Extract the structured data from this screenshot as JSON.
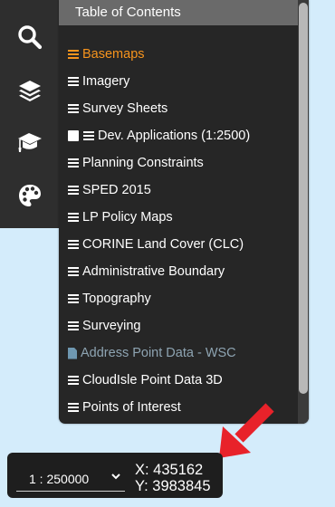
{
  "sidebar": {
    "buttons": [
      {
        "icon": "search-icon"
      },
      {
        "icon": "layers-icon"
      },
      {
        "icon": "graduation-cap-icon"
      },
      {
        "icon": "palette-icon"
      }
    ]
  },
  "toc": {
    "title": "Table of Contents",
    "items": [
      {
        "label": "Basemaps",
        "state": "active",
        "icon": "menu-icon"
      },
      {
        "label": "Imagery",
        "icon": "menu-icon"
      },
      {
        "label": "Survey Sheets",
        "icon": "menu-icon"
      },
      {
        "label": "Dev. Applications (1:2500)",
        "icon": "menu-icon",
        "checkbox": true
      },
      {
        "label": "Planning Constraints",
        "icon": "menu-icon"
      },
      {
        "label": "SPED 2015",
        "icon": "menu-icon"
      },
      {
        "label": "LP Policy Maps",
        "icon": "menu-icon"
      },
      {
        "label": "CORINE Land Cover (CLC)",
        "icon": "menu-icon"
      },
      {
        "label": "Administrative Boundary",
        "icon": "menu-icon"
      },
      {
        "label": "Topography",
        "icon": "menu-icon"
      },
      {
        "label": "Surveying",
        "icon": "menu-icon"
      },
      {
        "label": "Address Point Data - WSC",
        "state": "disabled",
        "icon": "document-icon"
      },
      {
        "label": "CloudIsle Point Data 3D",
        "icon": "menu-icon"
      },
      {
        "label": "Points of Interest",
        "icon": "menu-icon"
      }
    ]
  },
  "scale": {
    "value": "1 : 250000",
    "x_label": "X: 435162",
    "y_label": "Y: 3983845"
  },
  "colors": {
    "accent": "#f7941d",
    "arrow": "#e8222a",
    "panel": "#262626",
    "map": "#d4ecfb"
  }
}
